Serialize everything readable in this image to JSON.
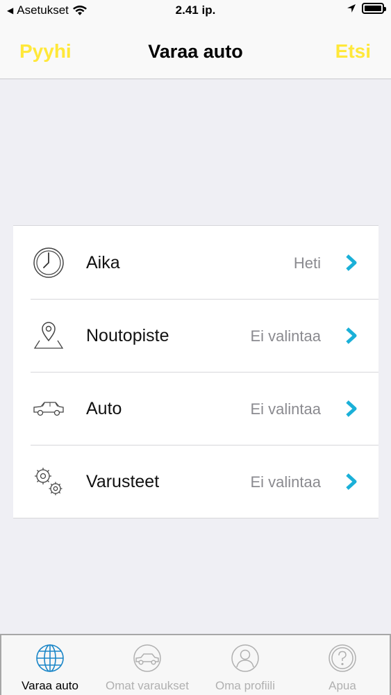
{
  "status_bar": {
    "back_label": "Asetukset",
    "time": "2.41 ip."
  },
  "nav": {
    "left_label": "Pyyhi",
    "title": "Varaa auto",
    "right_label": "Etsi",
    "accent_color": "#ffe83a"
  },
  "rows": [
    {
      "icon": "clock-icon",
      "label": "Aika",
      "value": "Heti"
    },
    {
      "icon": "location-pin-icon",
      "label": "Noutopiste",
      "value": "Ei valintaa"
    },
    {
      "icon": "car-icon",
      "label": "Auto",
      "value": "Ei valintaa"
    },
    {
      "icon": "gears-icon",
      "label": "Varusteet",
      "value": "Ei valintaa"
    }
  ],
  "chevron_color": "#1ab0d8",
  "tabs": [
    {
      "icon": "globe-icon",
      "label": "Varaa auto",
      "active": true
    },
    {
      "icon": "car-circle-icon",
      "label": "Omat varaukset",
      "active": false
    },
    {
      "icon": "person-icon",
      "label": "Oma profiili",
      "active": false
    },
    {
      "icon": "help-icon",
      "label": "Apua",
      "active": false
    }
  ]
}
